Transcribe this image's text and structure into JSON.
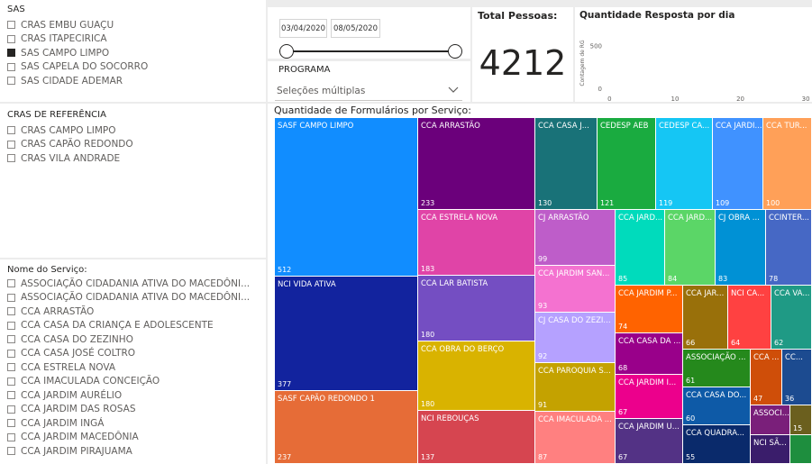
{
  "sas": {
    "title": "SAS",
    "items": [
      {
        "label": "CRAS EMBU GUAÇU",
        "checked": false
      },
      {
        "label": "CRAS ITAPECIRICA",
        "checked": false
      },
      {
        "label": "SAS CAMPO LIMPO",
        "checked": true
      },
      {
        "label": "SAS CAPELA DO SOCORRO",
        "checked": false
      },
      {
        "label": "SAS CIDADE ADEMAR",
        "checked": false
      }
    ]
  },
  "cras_ref": {
    "title": "CRAS DE REFERÊNCIA",
    "items": [
      {
        "label": "CRAS CAMPO LIMPO",
        "checked": false
      },
      {
        "label": "CRAS CAPÃO REDONDO",
        "checked": false
      },
      {
        "label": "CRAS VILA ANDRADE",
        "checked": false
      }
    ]
  },
  "servico": {
    "title": "Nome do Serviço:",
    "items": [
      {
        "label": "ASSOCIAÇÃO CIDADANIA ATIVA DO MACEDÔNI...",
        "checked": false
      },
      {
        "label": "ASSOCIAÇÃO CIDADANIA ATIVA DO MACEDÔNI...",
        "checked": false
      },
      {
        "label": "CCA ARRASTÃO",
        "checked": false
      },
      {
        "label": "CCA CASA DA CRIANÇA E ADOLESCENTE",
        "checked": false
      },
      {
        "label": "CCA CASA DO ZEZINHO",
        "checked": false
      },
      {
        "label": "CCA CASA JOSÉ COLTRO",
        "checked": false
      },
      {
        "label": "CCA ESTRELA NOVA",
        "checked": false
      },
      {
        "label": "CCA IMACULADA CONCEIÇÃO",
        "checked": false
      },
      {
        "label": "CCA JARDIM AURÉLIO",
        "checked": false
      },
      {
        "label": "CCA JARDIM DAS ROSAS",
        "checked": false
      },
      {
        "label": "CCA JARDIM INGÁ",
        "checked": false
      },
      {
        "label": "CCA JARDIM MACEDÔNIA",
        "checked": false
      },
      {
        "label": "CCA JARDIM PIRAJUAMA",
        "checked": false
      }
    ]
  },
  "date_slicer": {
    "start": "03/04/2020",
    "end": "08/05/2020"
  },
  "programa": {
    "title": "PROGRAMA",
    "value": "Seleções múltiplas"
  },
  "kpi": {
    "title": "Total Pessoas:",
    "value": "4212"
  },
  "daily_chart": {
    "title": "Quantidade Resposta por dia",
    "chart_data": {
      "type": "bar",
      "x": [
        1,
        2,
        3,
        4,
        5,
        6,
        7,
        8,
        9,
        10,
        11,
        12,
        13,
        14,
        15,
        16,
        17,
        18,
        19,
        20,
        21,
        22,
        23,
        24,
        25,
        26,
        27,
        28,
        29,
        30,
        31
      ],
      "values": [
        0,
        0,
        0,
        0,
        0,
        0,
        0,
        0,
        0,
        0,
        0,
        0,
        0,
        0,
        0,
        0,
        0,
        0,
        0,
        0,
        0,
        0,
        0,
        0,
        0,
        0,
        0,
        0,
        0,
        0,
        0
      ],
      "ylabel": "Contagem de RG",
      "yticks": [
        "0",
        "500"
      ],
      "xticks": [
        "0",
        "10",
        "20",
        "30"
      ],
      "color": "#118dff"
    }
  },
  "treemap": {
    "title": "Quantidade de Formulários por Serviço:",
    "cells": [
      {
        "label": "SASF CAMPO LIMPO",
        "value": "512",
        "color": "#118dff"
      },
      {
        "label": "NCI VIDA ATIVA",
        "value": "377",
        "color": "#12239e"
      },
      {
        "label": "SASF CAPÃO REDONDO 1",
        "value": "237",
        "color": "#e66c37"
      },
      {
        "label": "CCA ARRASTÃO",
        "value": "233",
        "color": "#6b007b"
      },
      {
        "label": "CCA ESTRELA NOVA",
        "value": "183",
        "color": "#e044a7"
      },
      {
        "label": "CCA LAR BATISTA",
        "value": "180",
        "color": "#744ec2"
      },
      {
        "label": "CCA OBRA DO BERÇO",
        "value": "180",
        "color": "#d9b300"
      },
      {
        "label": "NCI REBOUÇAS",
        "value": "137",
        "color": "#d64550"
      },
      {
        "label": "CCA CASA J...",
        "value": "130",
        "color": "#197278"
      },
      {
        "label": "CEDESP AEB",
        "value": "121",
        "color": "#1aab40"
      },
      {
        "label": "CEDESP CA...",
        "value": "119",
        "color": "#15c6f4"
      },
      {
        "label": "CCA JARDI...",
        "value": "109",
        "color": "#4092ff"
      },
      {
        "label": "CCA TUR...",
        "value": "100",
        "color": "#ffa058"
      },
      {
        "label": "CJ ARRASTÃO",
        "value": "99",
        "color": "#be5dc9"
      },
      {
        "label": "CCA JARDIM SAN...",
        "value": "93",
        "color": "#f472d0"
      },
      {
        "label": "CJ CASA DO ZEZI...",
        "value": "92",
        "color": "#b5a1ff"
      },
      {
        "label": "CCA PAROQUIA S...",
        "value": "91",
        "color": "#c4a200"
      },
      {
        "label": "CCA IMACULADA ...",
        "value": "87",
        "color": "#ff8080"
      },
      {
        "label": "CCA JARD...",
        "value": "85",
        "color": "#00dbbc"
      },
      {
        "label": "CCA JARD...",
        "value": "84",
        "color": "#5bd667"
      },
      {
        "label": "CJ OBRA ...",
        "value": "83",
        "color": "#0091d5"
      },
      {
        "label": "CCINTER...",
        "value": "78",
        "color": "#4668c5"
      },
      {
        "label": "CCA JARDIM P...",
        "value": "74",
        "color": "#ff6300"
      },
      {
        "label": "CCA CASA DA ...",
        "value": "68",
        "color": "#99008a"
      },
      {
        "label": "CCA JARDIM I...",
        "value": "67",
        "color": "#ec008c"
      },
      {
        "label": "CCA JARDIM U...",
        "value": "67",
        "color": "#533285"
      },
      {
        "label": "CCA JAR...",
        "value": "66",
        "color": "#99700a"
      },
      {
        "label": "NCI CA...",
        "value": "64",
        "color": "#ff4141"
      },
      {
        "label": "CCA VA...",
        "value": "62",
        "color": "#1f9a85"
      },
      {
        "label": "ASSOCIAÇÃO ...",
        "value": "61",
        "color": "#25891c"
      },
      {
        "label": "CCA ...",
        "value": "47",
        "color": "#cf4e09"
      },
      {
        "label": "CC...",
        "value": "36",
        "color": "#1c4b90"
      },
      {
        "label": "CCA CASA DO...",
        "value": "60",
        "color": "#0e5aa7"
      },
      {
        "label": "ASSOCI...",
        "value": "",
        "color": "#7a1f7a"
      },
      {
        "label": "",
        "value": "15",
        "color": "#6b5f1e"
      },
      {
        "label": "CCA QUADRA...",
        "value": "55",
        "color": "#0a2a6b"
      },
      {
        "label": "NCI SÃ...",
        "value": "",
        "color": "#3a1d6b"
      },
      {
        "label": "",
        "value": "",
        "color": "#1e8e3e"
      }
    ]
  }
}
